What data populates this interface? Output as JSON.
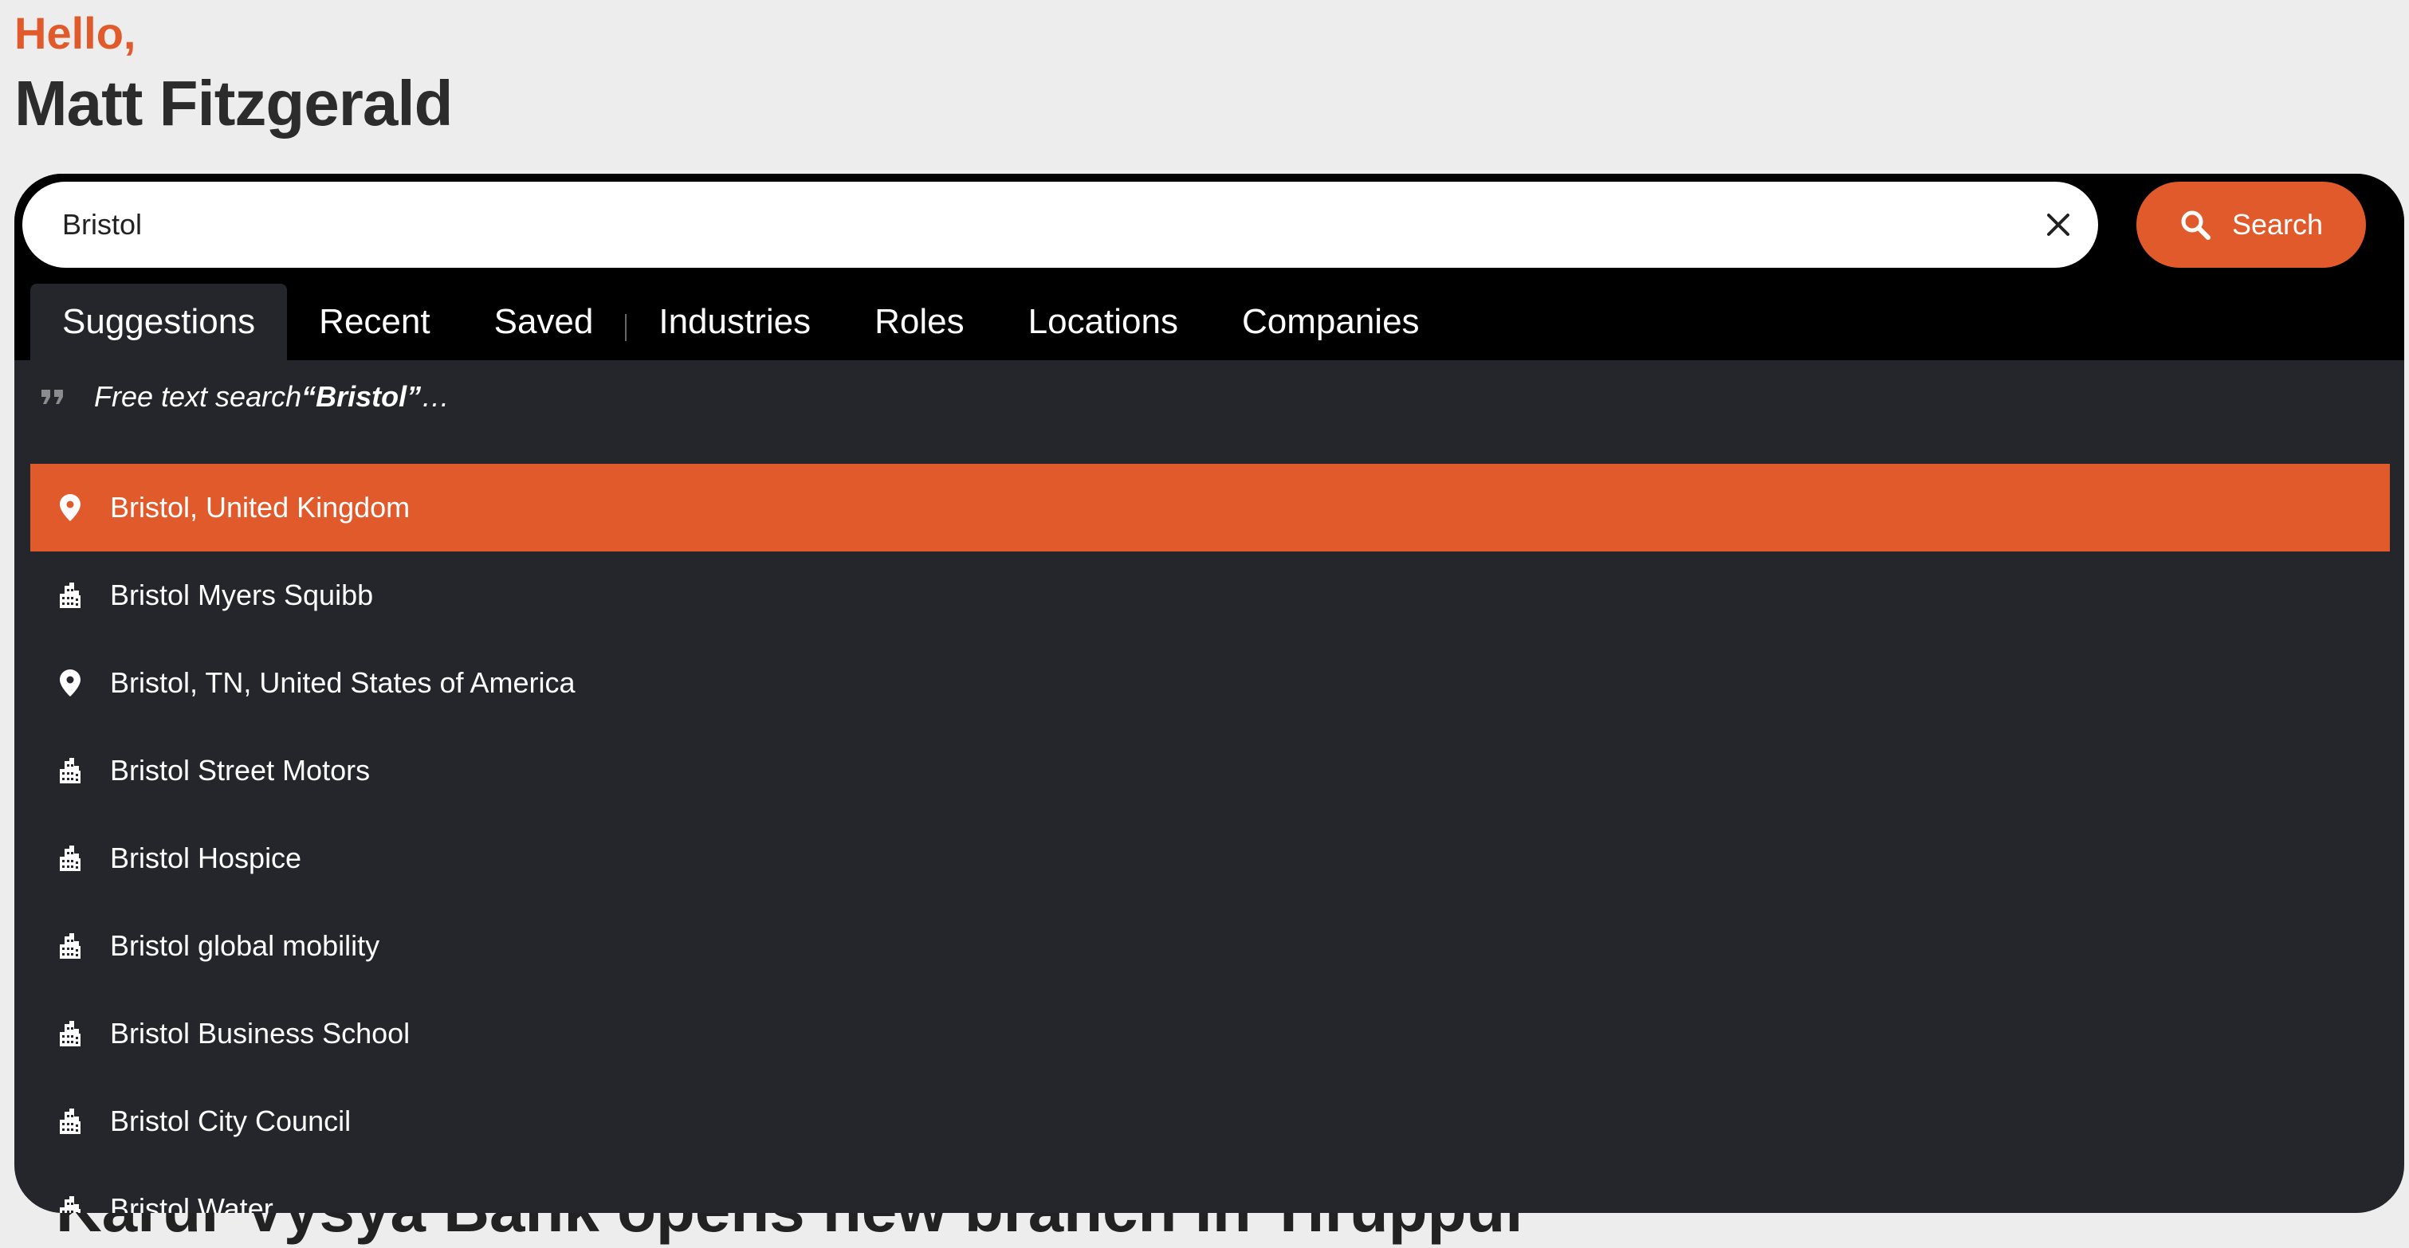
{
  "greeting": {
    "hello": "Hello,",
    "user_name": "Matt Fitzgerald"
  },
  "background": {
    "headline": "Karur Vysya Bank opens new branch in Tiruppur"
  },
  "search": {
    "value": "Bristol",
    "clear_icon": "close-icon",
    "button_label": "Search",
    "button_icon": "search-icon"
  },
  "tabs": [
    {
      "label": "Suggestions",
      "active": true
    },
    {
      "label": "Recent"
    },
    {
      "label": "Saved"
    },
    {
      "label": "Industries"
    },
    {
      "label": "Roles"
    },
    {
      "label": "Locations"
    },
    {
      "label": "Companies"
    }
  ],
  "free_text": {
    "prefix": "Free text search ",
    "query": "“Bristol”",
    "suffix": "…",
    "icon": "quote-icon"
  },
  "suggestions": [
    {
      "label": "Bristol, United Kingdom",
      "type": "location",
      "icon": "location-pin-icon",
      "selected": true
    },
    {
      "label": "Bristol Myers Squibb",
      "type": "company",
      "icon": "building-icon"
    },
    {
      "label": "Bristol, TN, United States of America",
      "type": "location",
      "icon": "location-pin-icon"
    },
    {
      "label": "Bristol Street Motors",
      "type": "company",
      "icon": "building-icon"
    },
    {
      "label": "Bristol Hospice",
      "type": "company",
      "icon": "building-icon"
    },
    {
      "label": "Bristol global mobility",
      "type": "company",
      "icon": "building-icon"
    },
    {
      "label": "Bristol Business School",
      "type": "company",
      "icon": "building-icon"
    },
    {
      "label": "Bristol City Council",
      "type": "company",
      "icon": "building-icon"
    },
    {
      "label": "Bristol Water",
      "type": "company",
      "icon": "building-icon"
    }
  ],
  "colors": {
    "accent": "#e05a2b",
    "panel_bg": "#24262b",
    "topbar_bg": "#000000",
    "page_bg": "#ededed"
  }
}
